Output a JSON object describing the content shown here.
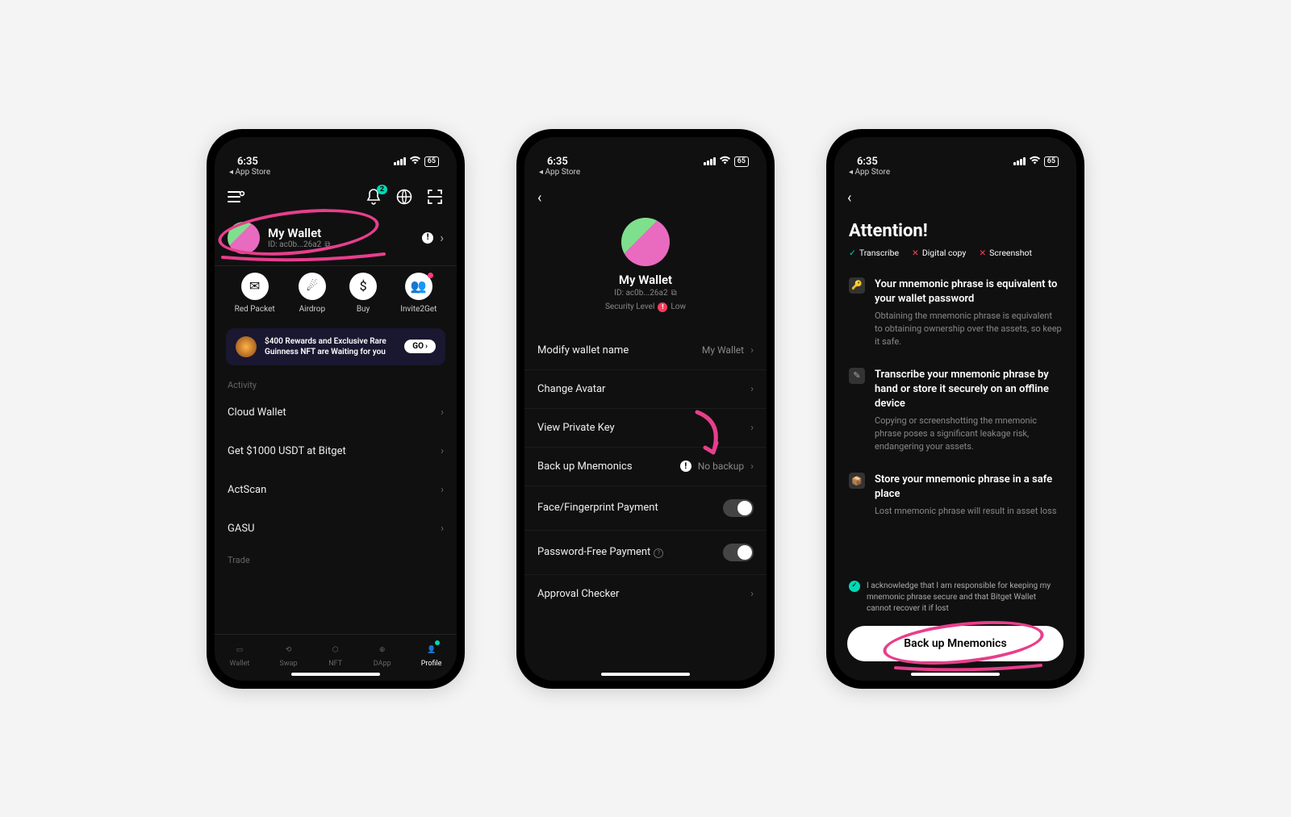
{
  "status": {
    "time": "6:35",
    "breadcrumb": "◂ App Store",
    "battery": "65"
  },
  "p1": {
    "bell_badge": "2",
    "wallet": {
      "name": "My Wallet",
      "id": "ID: ac0b...26a2"
    },
    "quick": [
      "Red Packet",
      "Airdrop",
      "Buy",
      "Invite2Get"
    ],
    "banner": {
      "text": "$400 Rewards and Exclusive Rare Guinness NFT are Waiting for you",
      "btn": "GO"
    },
    "section_activity": "Activity",
    "rows": [
      "Cloud Wallet",
      "Get $1000 USDT at Bitget",
      "ActScan",
      "GASU"
    ],
    "section_trade": "Trade",
    "tabs": [
      "Wallet",
      "Swap",
      "NFT",
      "DApp",
      "Profile"
    ]
  },
  "p2": {
    "wallet": {
      "name": "My Wallet",
      "id": "ID: ac0b...26a2"
    },
    "sec_label": "Security Level",
    "sec_value": "Low",
    "rows": {
      "modify": "Modify wallet name",
      "modify_val": "My Wallet",
      "avatar": "Change Avatar",
      "pkey": "View Private Key",
      "backup": "Back up Mnemonics",
      "backup_val": "No backup",
      "face": "Face/Fingerprint Payment",
      "pwfree": "Password-Free Payment",
      "approval": "Approval Checker"
    }
  },
  "p3": {
    "title": "Attention!",
    "rules": [
      "Transcribe",
      "Digital copy",
      "Screenshot"
    ],
    "blocks": [
      {
        "title": "Your mnemonic phrase is equivalent to your wallet password",
        "desc": "Obtaining the mnemonic phrase is equivalent to obtaining ownership over the assets, so keep it safe."
      },
      {
        "title": "Transcribe your mnemonic phrase by hand or store it securely on an offline device",
        "desc": "Copying or screenshotting the mnemonic phrase poses a significant leakage risk, endangering your assets."
      },
      {
        "title": "Store your mnemonic phrase in a safe place",
        "desc": "Lost mnemonic phrase will result in asset loss"
      }
    ],
    "ack": "I acknowledge that I am responsible for keeping my mnemonic phrase secure and that Bitget Wallet cannot recover it if lost",
    "btn": "Back up Mnemonics"
  }
}
